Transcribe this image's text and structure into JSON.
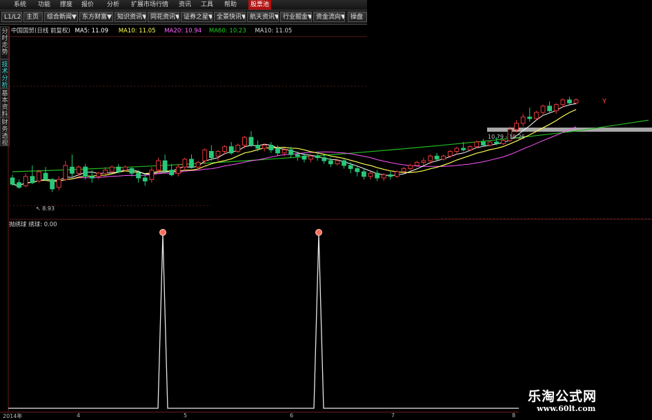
{
  "menu": [
    "系统",
    "功能",
    "报价",
    "分析",
    "扩展市场行情",
    "资讯",
    "工具",
    "帮助",
    "股票池"
  ],
  "menu_active_index": 8,
  "tabs": [
    "L1/L2",
    "主页",
    "综合新闻▼",
    "东方财富▼",
    "知识资讯▼",
    "同花资讯▼",
    "证券之星▼",
    "全景快讯▼",
    "航天资讯▼",
    "行业掘金▼",
    "资金流向▼",
    "操盘"
  ],
  "side_nav": [
    "分时走势",
    "技术分析",
    "基本资料",
    "财务透视"
  ],
  "side_nav_active_index": 1,
  "info_bar": {
    "title": "中国国贸(日线 前复权)",
    "ma5": "MA5: 11.09",
    "ma10": "MA10: 11.05",
    "ma20": "MA20: 10.94",
    "ma60": "MA60: 10.23",
    "ma10b": "MA10: 11.05"
  },
  "price_notes": {
    "low_label": "8.93",
    "range_label": "10.79 - 10.26",
    "marker_y": "Y"
  },
  "indicator_label": "抛绣球  绣球: 0.00",
  "x_axis_labels": [
    "2014年",
    "4",
    "5",
    "6",
    "7",
    "8"
  ],
  "watermark": {
    "text": "乐淘公式网",
    "url": "www.60lt.com"
  },
  "colors": {
    "bull": "#e83a3a",
    "bear": "#28c878",
    "ma5": "#ffffff",
    "ma10": "#ffff55",
    "ma20": "#ff55ff",
    "ma60": "#22bb22",
    "menu_active": "#b01010"
  },
  "chart_data": {
    "type": "candlestick",
    "price_range": [
      8.8,
      12.2
    ],
    "candles": [
      [
        9.55,
        9.65,
        9.35,
        9.3
      ],
      [
        9.4,
        9.5,
        9.25,
        9.2
      ],
      [
        9.3,
        9.7,
        9.6,
        9.25
      ],
      [
        9.6,
        9.95,
        9.4,
        9.35
      ],
      [
        9.45,
        9.8,
        9.75,
        9.4
      ],
      [
        9.7,
        9.9,
        9.5,
        9.45
      ],
      [
        9.5,
        9.55,
        9.2,
        9.1
      ],
      [
        9.25,
        9.6,
        9.5,
        9.15
      ],
      [
        9.5,
        10.1,
        9.95,
        9.45
      ],
      [
        9.9,
        10.3,
        9.7,
        9.6
      ],
      [
        9.7,
        9.95,
        9.9,
        9.6
      ],
      [
        9.9,
        10.0,
        9.6,
        9.5
      ],
      [
        9.6,
        9.8,
        9.55,
        9.4
      ],
      [
        9.6,
        9.75,
        9.7,
        9.5
      ],
      [
        9.7,
        9.9,
        9.8,
        9.6
      ],
      [
        9.75,
        9.95,
        9.9,
        9.7
      ],
      [
        9.9,
        10.0,
        9.75,
        9.7
      ],
      [
        9.8,
        9.95,
        9.9,
        9.75
      ],
      [
        9.85,
        9.9,
        9.7,
        9.6
      ],
      [
        9.7,
        9.8,
        9.55,
        9.4
      ],
      [
        9.55,
        9.7,
        9.45,
        9.3
      ],
      [
        9.5,
        9.9,
        9.8,
        9.4
      ],
      [
        9.8,
        10.2,
        10.1,
        9.7
      ],
      [
        10.1,
        10.3,
        9.8,
        9.7
      ],
      [
        9.8,
        10.0,
        9.65,
        9.6
      ],
      [
        9.7,
        10.0,
        9.9,
        9.6
      ],
      [
        9.9,
        10.2,
        10.15,
        9.8
      ],
      [
        10.15,
        10.3,
        9.9,
        9.85
      ],
      [
        9.9,
        10.1,
        10.05,
        9.8
      ],
      [
        10.1,
        10.5,
        10.45,
        10.0
      ],
      [
        10.4,
        10.6,
        10.2,
        10.1
      ],
      [
        10.25,
        10.45,
        10.4,
        10.1
      ],
      [
        10.4,
        10.6,
        10.55,
        10.3
      ],
      [
        10.55,
        10.7,
        10.35,
        10.3
      ],
      [
        10.4,
        10.65,
        10.6,
        10.35
      ],
      [
        10.6,
        10.9,
        10.85,
        10.5
      ],
      [
        10.85,
        11.05,
        10.6,
        10.55
      ],
      [
        10.6,
        10.75,
        10.5,
        10.4
      ],
      [
        10.5,
        10.65,
        10.6,
        10.4
      ],
      [
        10.6,
        10.7,
        10.45,
        10.35
      ],
      [
        10.5,
        10.6,
        10.35,
        10.25
      ],
      [
        10.35,
        10.5,
        10.45,
        10.25
      ],
      [
        10.45,
        10.55,
        10.3,
        10.2
      ],
      [
        10.3,
        10.4,
        10.25,
        10.1
      ],
      [
        10.25,
        10.35,
        10.15,
        10.05
      ],
      [
        10.15,
        10.3,
        10.25,
        10.05
      ],
      [
        10.25,
        10.4,
        10.2,
        10.1
      ],
      [
        10.2,
        10.3,
        10.1,
        10.0
      ],
      [
        10.1,
        10.2,
        10.0,
        9.9
      ],
      [
        10.0,
        10.15,
        10.1,
        9.95
      ],
      [
        10.1,
        10.2,
        9.95,
        9.85
      ],
      [
        9.95,
        10.05,
        9.85,
        9.7
      ],
      [
        9.85,
        9.95,
        9.75,
        9.6
      ],
      [
        9.75,
        9.85,
        9.6,
        9.5
      ],
      [
        9.6,
        9.75,
        9.7,
        9.5
      ],
      [
        9.7,
        9.8,
        9.55,
        9.45
      ],
      [
        9.55,
        9.7,
        9.65,
        9.45
      ],
      [
        9.65,
        9.75,
        9.6,
        9.5
      ],
      [
        9.6,
        9.8,
        9.75,
        9.55
      ],
      [
        9.75,
        9.9,
        9.85,
        9.7
      ],
      [
        9.85,
        10.0,
        9.95,
        9.8
      ],
      [
        9.95,
        10.1,
        10.05,
        9.9
      ],
      [
        10.05,
        10.2,
        10.1,
        9.95
      ],
      [
        10.1,
        10.3,
        10.25,
        10.0
      ],
      [
        10.25,
        10.35,
        10.15,
        10.1
      ],
      [
        10.15,
        10.3,
        10.25,
        10.1
      ],
      [
        10.25,
        10.45,
        10.4,
        10.2
      ],
      [
        10.4,
        10.55,
        10.5,
        10.3
      ],
      [
        10.5,
        10.7,
        10.45,
        10.4
      ],
      [
        10.45,
        10.6,
        10.55,
        10.4
      ],
      [
        10.55,
        10.75,
        10.7,
        10.5
      ],
      [
        10.7,
        10.8,
        10.6,
        10.55
      ],
      [
        10.6,
        10.75,
        10.7,
        10.55
      ],
      [
        10.7,
        10.85,
        10.65,
        10.6
      ],
      [
        10.65,
        10.8,
        10.75,
        10.6
      ],
      [
        10.75,
        11.2,
        11.1,
        10.7
      ],
      [
        11.1,
        11.4,
        11.3,
        11.0
      ],
      [
        11.3,
        11.6,
        11.5,
        11.2
      ],
      [
        11.5,
        11.8,
        11.45,
        11.35
      ],
      [
        11.45,
        11.7,
        11.65,
        11.4
      ],
      [
        11.65,
        11.9,
        11.85,
        11.55
      ],
      [
        11.85,
        12.0,
        11.7,
        11.65
      ],
      [
        11.7,
        11.95,
        11.9,
        11.6
      ],
      [
        11.9,
        12.1,
        12.05,
        11.8
      ],
      [
        12.05,
        12.15,
        11.95,
        11.9
      ],
      [
        11.95,
        12.1,
        12.05,
        11.9
      ]
    ],
    "indicator": {
      "name": "绣球",
      "value": 0.0,
      "spikes_at_candle": [
        21,
        43
      ]
    },
    "ma60_endpoints": [
      [
        0,
        9.75
      ],
      [
        45,
        9.95
      ],
      [
        85,
        11.05
      ]
    ]
  }
}
